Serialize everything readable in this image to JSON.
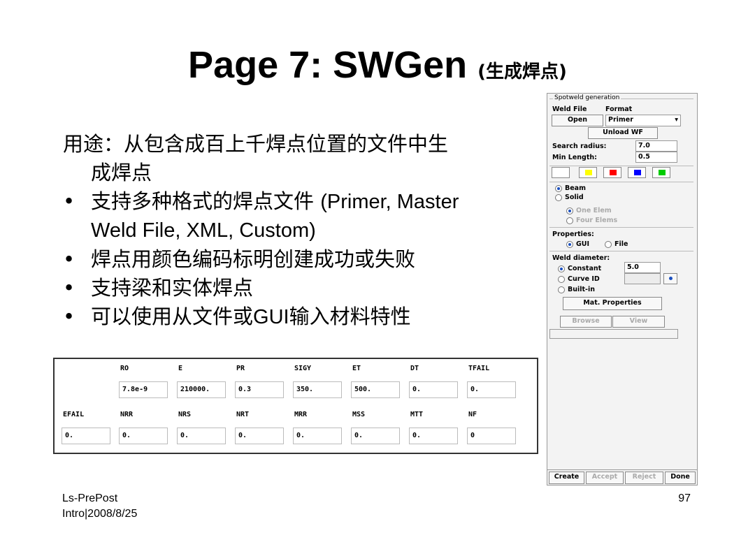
{
  "title": {
    "main": "Page 7: SWGen ",
    "sub": "(生成焊点)"
  },
  "bullets": {
    "intro_line1": "用途：从包含成百上千焊点位置的文件中生",
    "intro_line2": "成焊点",
    "bullet_symbol": "•",
    "b1_cn": "支持多种格式的焊点文件 ",
    "b1_en": "(Primer, Master",
    "b1_line2": "Weld File, XML, Custom)",
    "b2": "焊点用颜色编码标明创建成功或失败",
    "b3": "支持梁和实体焊点",
    "b4_cn1": "可以使用从文件或",
    "b4_en": "GUI",
    "b4_cn2": "输入材料特性"
  },
  "material_table": {
    "row1_headers": [
      "RO",
      "E",
      "PR",
      "SIGY",
      "ET",
      "DT",
      "TFAIL"
    ],
    "row1_values": [
      "7.8e-9",
      "210000.",
      "0.3",
      "350.",
      "500.",
      "0.",
      "0."
    ],
    "row2_headers": [
      "EFAIL",
      "NRR",
      "NRS",
      "NRT",
      "MRR",
      "MSS",
      "MTT",
      "NF"
    ],
    "row2_values": [
      "0.",
      "0.",
      "0.",
      "0.",
      "0.",
      "0.",
      "0.",
      "0"
    ]
  },
  "panel": {
    "group_title": "Spotweld generation",
    "weld_file_label": "Weld File",
    "format_label": "Format",
    "open_button": "Open",
    "format_value": "Primer",
    "dropdown_icon": "▾",
    "unload_button": "Unload WF",
    "search_radius_label": "Search radius:",
    "search_radius_value": "7.0",
    "min_length_label": "Min Length:",
    "min_length_value": "0.5",
    "colors": [
      "#ffffff",
      "#ffff00",
      "#ff0000",
      "#0000ff",
      "#00cc00"
    ],
    "beam_label": "Beam",
    "solid_label": "Solid",
    "one_elem_label": "One Elem",
    "four_elems_label": "Four Elems",
    "properties_label": "Properties:",
    "gui_label": "GUI",
    "file_label": "File",
    "weld_diameter_label": "Weld diameter:",
    "constant_label": "Constant",
    "constant_value": "5.0",
    "curve_id_label": "Curve ID",
    "builtin_label": "Built-in",
    "mat_properties_button": "Mat. Properties",
    "browse_button": "Browse",
    "view_button": "View",
    "create_button": "Create",
    "accept_button": "Accept",
    "reject_button": "Reject",
    "done_button": "Done",
    "accent_color": "#1a4fbf"
  },
  "footer": {
    "left_line1": "Ls-PrePost",
    "left_line2": "Intro|2008/8/25",
    "page_number": "97"
  }
}
